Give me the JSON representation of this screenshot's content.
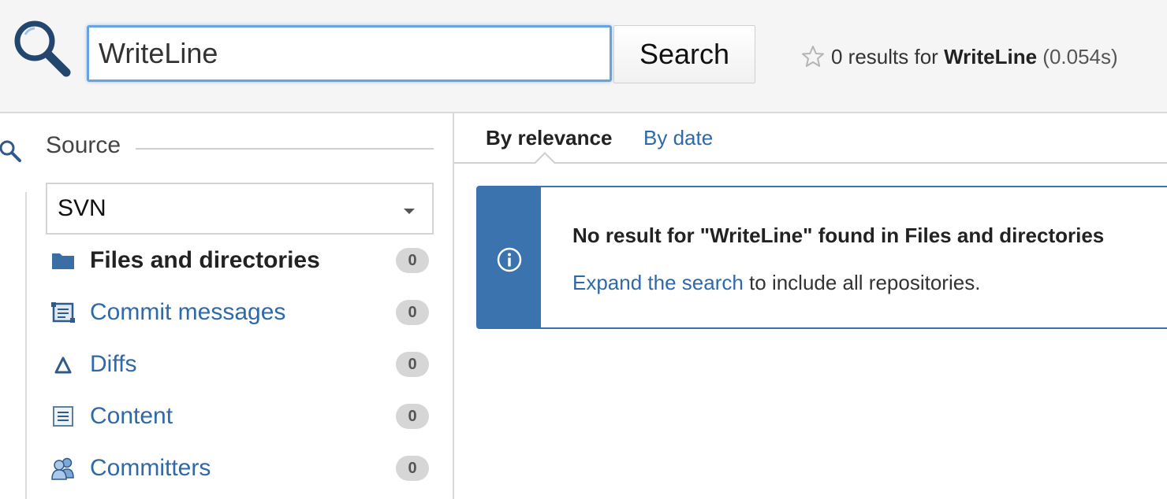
{
  "header": {
    "logo_icon": "magnifier-icon",
    "search_value": "WriteLine",
    "search_button_label": "Search",
    "result_count": "0 results for",
    "query": "WriteLine",
    "time": "(0.054s)",
    "star_icon": "star-outline-icon"
  },
  "sidebar": {
    "title": "Source",
    "source_select": {
      "selected": "SVN"
    },
    "facets": [
      {
        "label": "Files and directories",
        "count": "0",
        "icon": "folder-icon",
        "active": true
      },
      {
        "label": "Commit messages",
        "count": "0",
        "icon": "commit-message-icon",
        "active": false
      },
      {
        "label": "Diffs",
        "count": "0",
        "icon": "delta-icon",
        "active": false
      },
      {
        "label": "Content",
        "count": "0",
        "icon": "content-document-icon",
        "active": false
      },
      {
        "label": "Committers",
        "count": "0",
        "icon": "users-icon",
        "active": false
      }
    ]
  },
  "main": {
    "tabs": [
      {
        "label": "By relevance",
        "active": true
      },
      {
        "label": "By date",
        "active": false
      }
    ],
    "notice": {
      "title": "No result for \"WriteLine\" found in Files and directories",
      "link_text": "Expand the search",
      "text_after_link": " to include all repositories.",
      "icon": "info-icon"
    }
  },
  "colors": {
    "accent": "#3a73ad",
    "link": "#2f69a8",
    "focus": "#66a3e0",
    "badge": "#d6d6d6"
  }
}
